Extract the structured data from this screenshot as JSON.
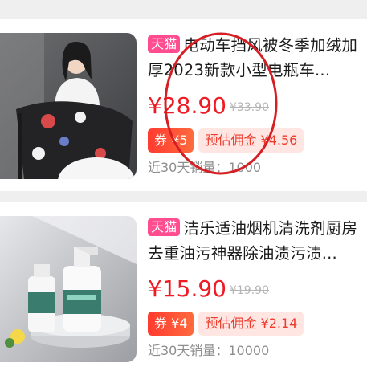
{
  "products": [
    {
      "badge": "天猫",
      "title": "电动车挡风被冬季加绒加厚2023新款小型电瓶车...",
      "price": "¥28.90",
      "original_price": "¥33.90",
      "coupon": "券 ¥5",
      "commission": "预估佣金 ¥4.56",
      "sales": "近30天销量：1000",
      "image_icon": "scooter-windshield-photo"
    },
    {
      "badge": "天猫",
      "title": "洁乐适油烟机清洗剂厨房去重油污神器除油渍污渍...",
      "price": "¥15.90",
      "original_price": "¥19.90",
      "coupon": "券 ¥4",
      "commission": "预估佣金 ¥2.14",
      "sales": "近30天销量：10000",
      "image_icon": "cleaner-bottles-photo"
    }
  ],
  "colors": {
    "price": "#ee1b24",
    "tmall_badge": "#ff4d8f",
    "coupon": "#ff3b2f",
    "commission_bg": "#ffe6e3",
    "annotation_circle": "#d51f24"
  }
}
